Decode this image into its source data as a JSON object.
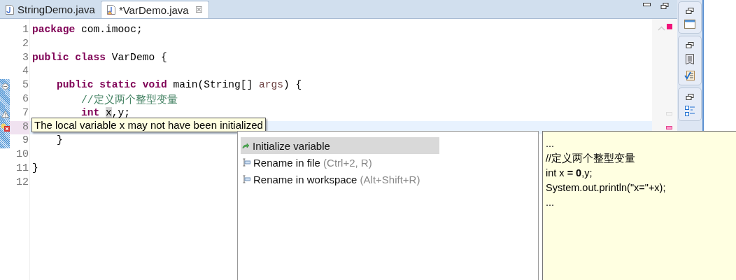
{
  "tabs": [
    {
      "label": "StringDemo.java",
      "selected": false
    },
    {
      "label": "*VarDemo.java",
      "selected": true,
      "close": "☒"
    }
  ],
  "editor": {
    "lines": [
      {
        "number": "1",
        "tokens": [
          {
            "kind": "keyword",
            "text": "package"
          },
          {
            "kind": "plain",
            "text": " com.imooc;"
          }
        ]
      },
      {
        "number": "2"
      },
      {
        "number": "3",
        "tokens": [
          {
            "kind": "keyword",
            "text": "public class"
          },
          {
            "kind": "plain",
            "text": " VarDemo {"
          }
        ]
      },
      {
        "number": "4"
      },
      {
        "number": "5",
        "changed": true,
        "kind": "fold",
        "tokens": [
          {
            "kind": "keyword",
            "text": "    public static void"
          },
          {
            "kind": "plain",
            "text": " main(String[] "
          },
          {
            "kind": "param",
            "text": "args"
          },
          {
            "kind": "plain",
            "text": ") {"
          }
        ]
      },
      {
        "number": "6",
        "changed": true,
        "tokens": [
          {
            "kind": "comment",
            "text": "        //定义两个整型变量"
          }
        ]
      },
      {
        "number": "7",
        "changed": true,
        "kind": "warning",
        "tokens": [
          {
            "kind": "keyword",
            "text": "        int "
          },
          {
            "kind": "occurrence",
            "text": "x"
          },
          {
            "kind": "plain",
            "text": ",y;"
          }
        ]
      },
      {
        "number": "8",
        "changed": true,
        "current": true,
        "kind": "error"
      },
      {
        "number": "9",
        "changed": true,
        "tokens": [
          {
            "kind": "plain",
            "text": "    }"
          }
        ]
      },
      {
        "number": "10"
      },
      {
        "number": "11",
        "tokens": [
          {
            "kind": "plain",
            "text": "}"
          }
        ]
      },
      {
        "number": "12"
      }
    ]
  },
  "tooltip": "The local variable x may not have been initialized",
  "quick_fix": {
    "items": [
      {
        "kind": "initialize",
        "label": "Initialize variable",
        "selected": true
      },
      {
        "kind": "rename",
        "label": "Rename in file",
        "shortcut": "(Ctrl+2, R)",
        "selected": false
      },
      {
        "kind": "rename",
        "label": "Rename in workspace",
        "shortcut": "(Alt+Shift+R)",
        "selected": false
      }
    ],
    "preview": [
      "...",
      "//定义两个整型变量",
      "int x **= 0**,y;",
      "System.out.println(\"x=\"+x);",
      "..."
    ]
  }
}
